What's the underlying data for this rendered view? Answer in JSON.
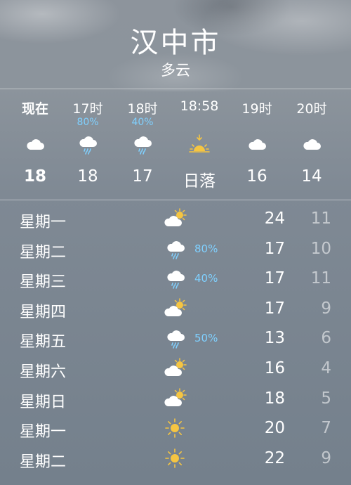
{
  "header": {
    "city": "汉中市",
    "condition": "多云"
  },
  "hourly": [
    {
      "time": "现在",
      "pct": "",
      "icon": "cloud-icon",
      "temp": "18"
    },
    {
      "time": "17时",
      "pct": "80%",
      "icon": "cloud-rain-icon",
      "temp": "18"
    },
    {
      "time": "18时",
      "pct": "40%",
      "icon": "cloud-rain-icon",
      "temp": "17"
    },
    {
      "time": "18:58",
      "pct": "",
      "icon": "sunset-icon",
      "temp": "日落"
    },
    {
      "time": "19时",
      "pct": "",
      "icon": "cloud-icon",
      "temp": "16"
    },
    {
      "time": "20时",
      "pct": "",
      "icon": "cloud-icon",
      "temp": "14"
    }
  ],
  "daily": [
    {
      "day": "星期一",
      "icon": "partly-cloudy-icon",
      "pct": "",
      "high": "24",
      "low": "11"
    },
    {
      "day": "星期二",
      "icon": "cloud-rain-icon",
      "pct": "80%",
      "high": "17",
      "low": "10"
    },
    {
      "day": "星期三",
      "icon": "cloud-rain-icon",
      "pct": "40%",
      "high": "17",
      "low": "11"
    },
    {
      "day": "星期四",
      "icon": "partly-cloudy-icon",
      "pct": "",
      "high": "17",
      "low": "9"
    },
    {
      "day": "星期五",
      "icon": "cloud-rain-icon",
      "pct": "50%",
      "high": "13",
      "low": "6"
    },
    {
      "day": "星期六",
      "icon": "partly-cloudy-icon",
      "pct": "",
      "high": "16",
      "low": "4"
    },
    {
      "day": "星期日",
      "icon": "partly-cloudy-icon",
      "pct": "",
      "high": "18",
      "low": "5"
    },
    {
      "day": "星期一",
      "icon": "sun-icon",
      "pct": "",
      "high": "20",
      "low": "7"
    },
    {
      "day": "星期二",
      "icon": "sun-icon",
      "pct": "",
      "high": "22",
      "low": "9"
    }
  ],
  "colors": {
    "precip": "#7fd0ff",
    "sun": "#f5c542"
  }
}
